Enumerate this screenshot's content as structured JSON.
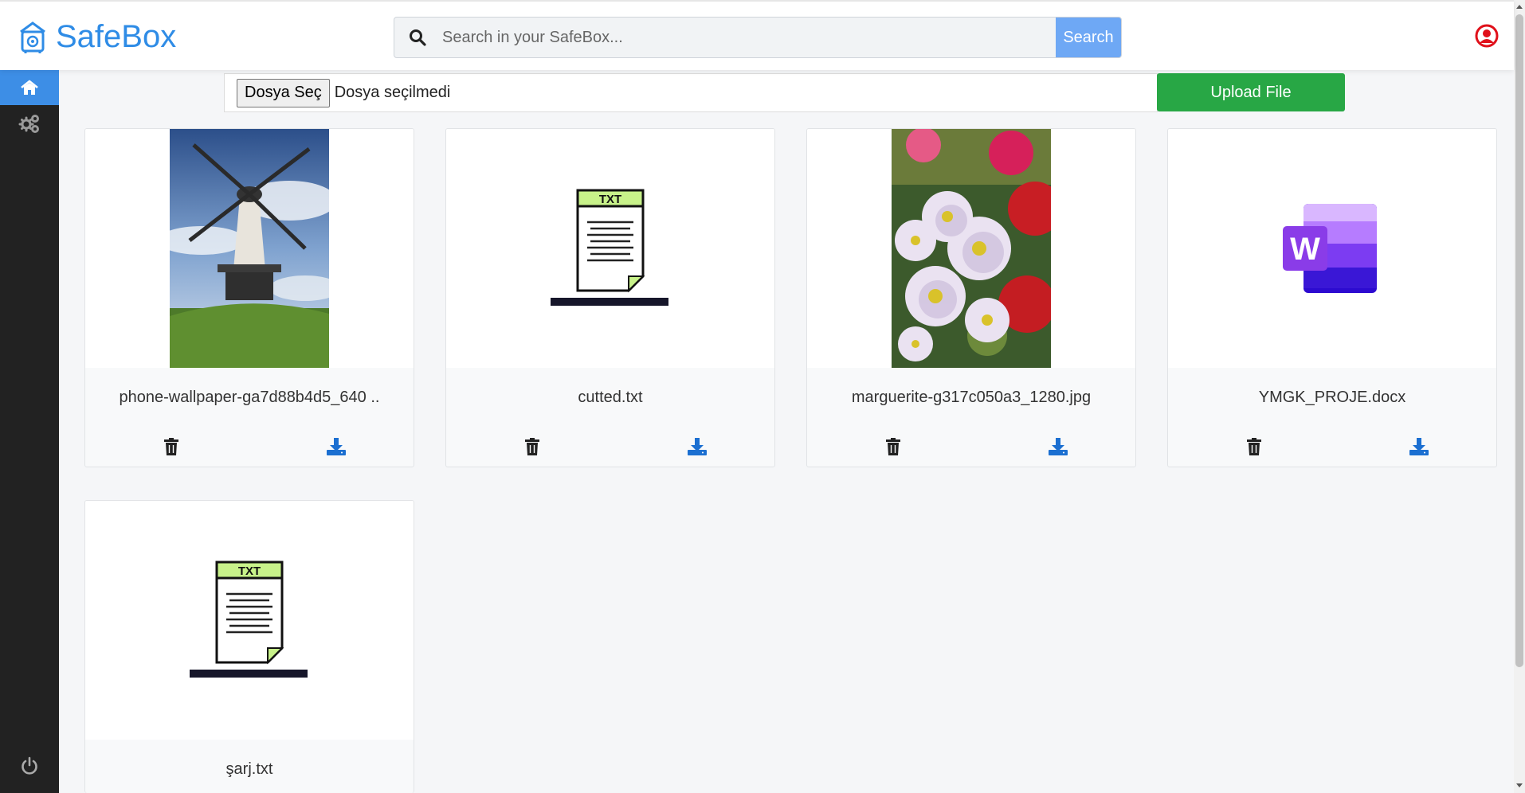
{
  "header": {
    "brand": "SafeBox",
    "search_placeholder": "Search in your SafeBox...",
    "search_button": "Search",
    "icons": {
      "logo": "safe-house-icon",
      "search": "search-icon",
      "user": "user-circle-icon"
    }
  },
  "sidebar": {
    "items": [
      {
        "name": "home",
        "icon": "home-icon",
        "active": true
      },
      {
        "name": "settings",
        "icon": "gears-icon",
        "active": false
      }
    ],
    "logout_icon": "power-icon"
  },
  "upload": {
    "choose_label": "Dosya Seç",
    "status": "Dosya seçilmedi",
    "button": "Upload File"
  },
  "files": [
    {
      "name": "phone-wallpaper-ga7d88b4d5_640 ..",
      "thumb": "windmill-photo"
    },
    {
      "name": "cutted.txt",
      "thumb": "txt-file-icon",
      "thumb_label": "TXT"
    },
    {
      "name": "marguerite-g317c050a3_1280.jpg",
      "thumb": "flowers-photo"
    },
    {
      "name": "YMGK_PROJE.docx",
      "thumb": "word-docx-icon",
      "thumb_label": "W"
    },
    {
      "name": "şarj.txt",
      "thumb": "txt-file-icon",
      "thumb_label": "TXT"
    }
  ],
  "card_actions": {
    "delete_icon": "trash-icon",
    "download_icon": "download-icon"
  },
  "colors": {
    "brand": "#2f8ce6",
    "sidebar": "#222222",
    "sidebar_active": "#3d8ee6",
    "search_button": "#6ea8f5",
    "upload_button": "#28a745",
    "user_icon": "#e0101a",
    "download_icon": "#1b6fd1"
  }
}
